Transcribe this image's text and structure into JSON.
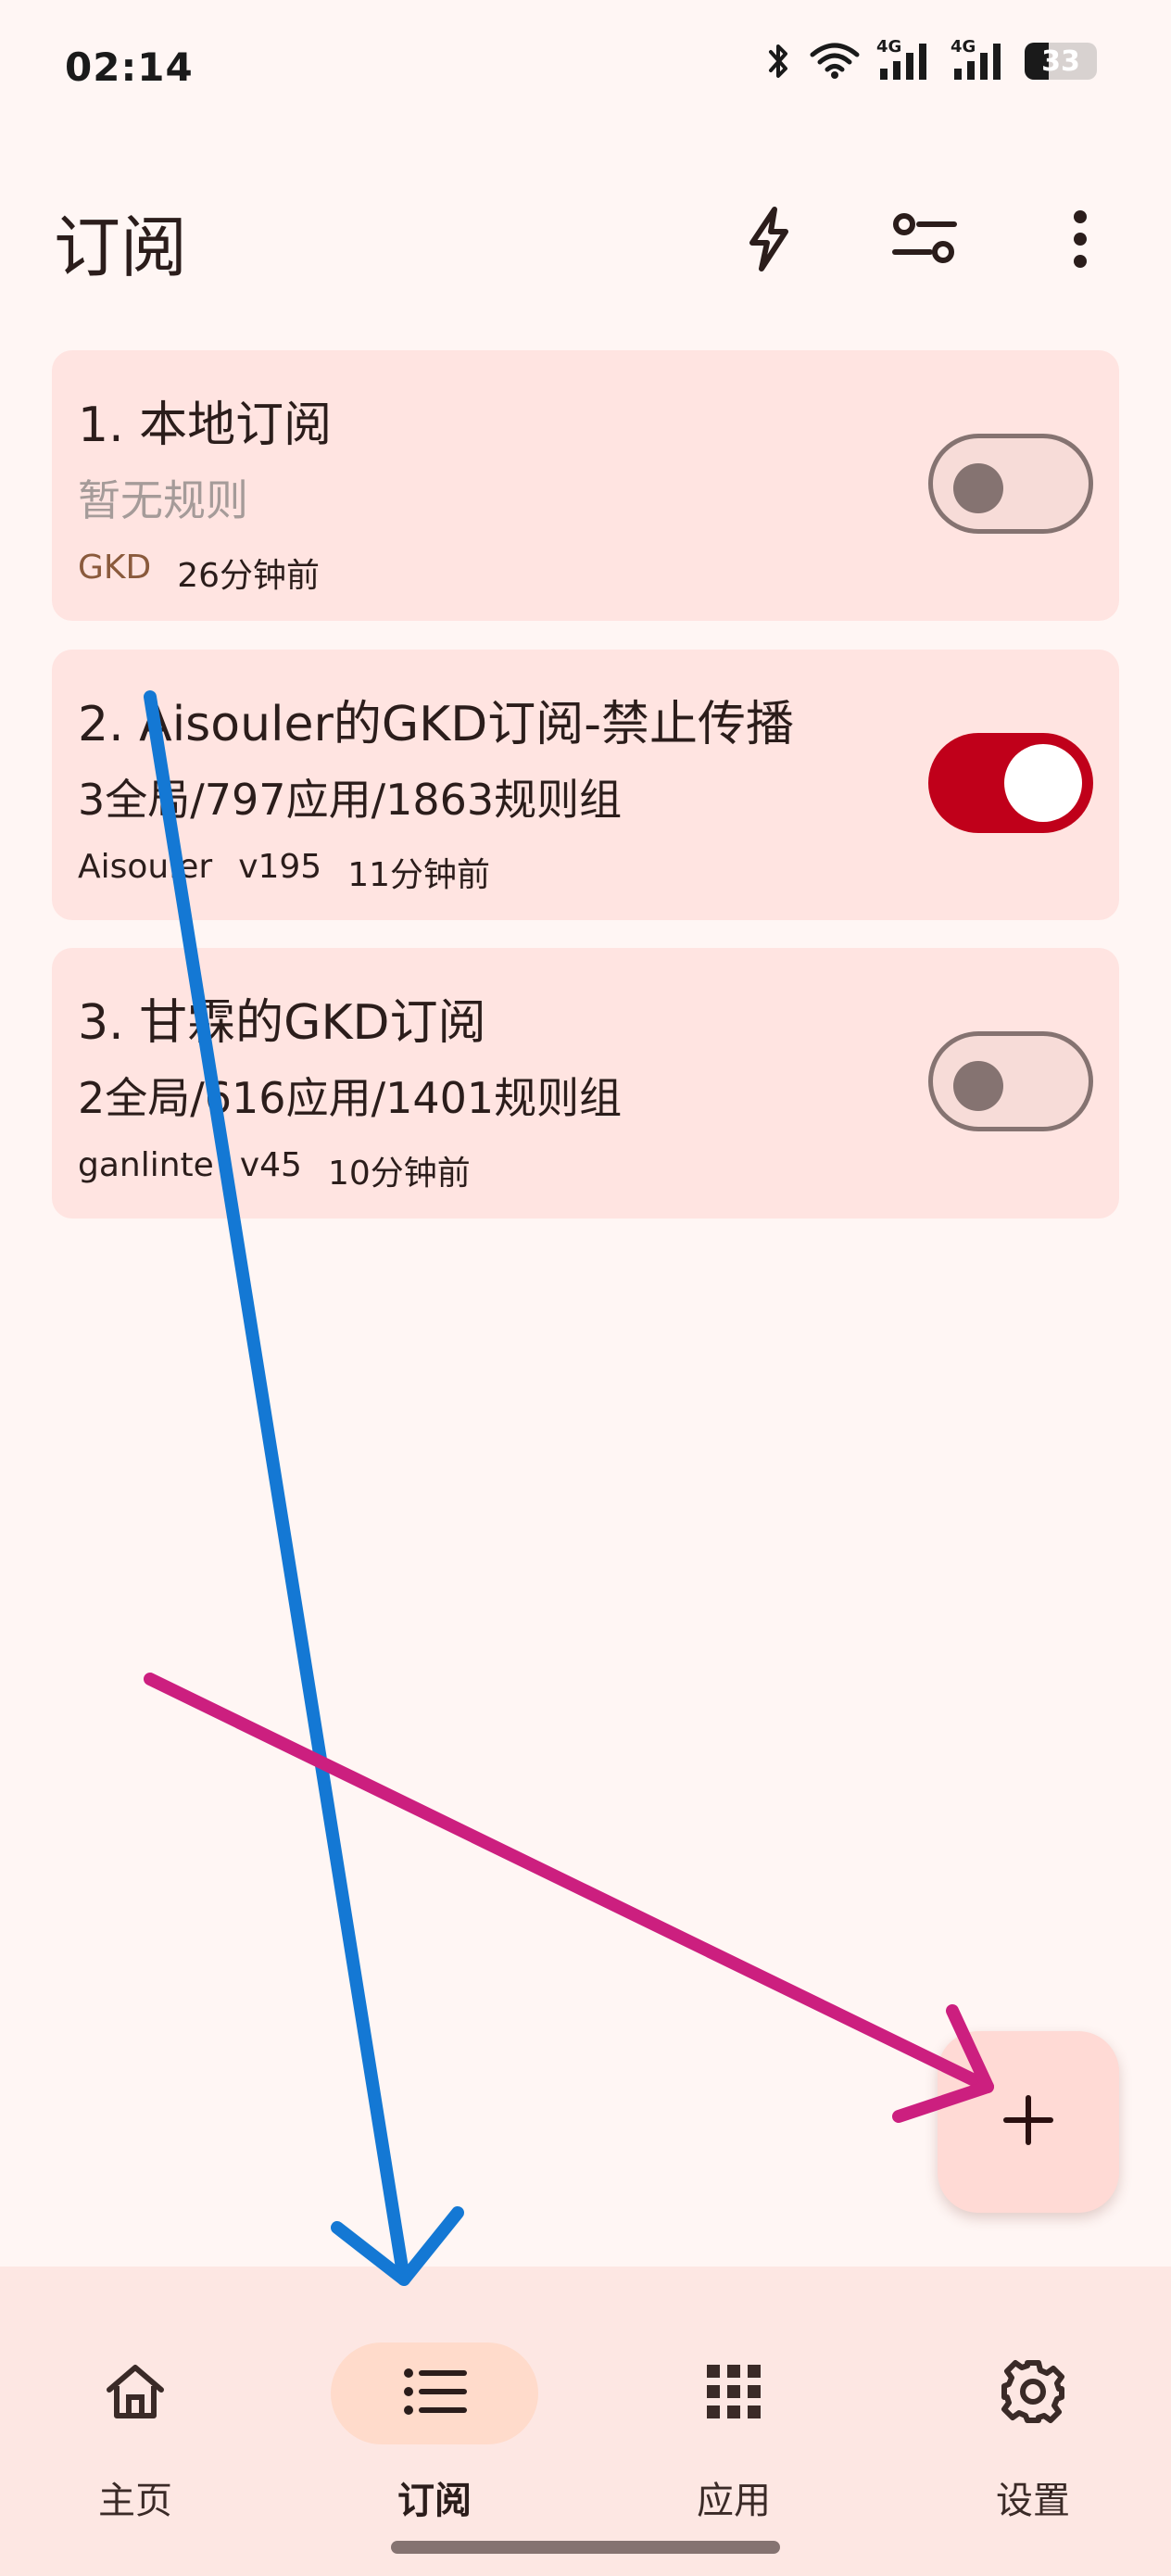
{
  "status_bar": {
    "time": "02:14",
    "battery": "33",
    "network_1": "4G",
    "network_2": "4G"
  },
  "app_bar": {
    "title": "订阅"
  },
  "subscriptions": [
    {
      "title": "1. 本地订阅",
      "subtitle": "暂无规则",
      "author": "GKD",
      "version": "",
      "updated": "26分钟前",
      "enabled": false
    },
    {
      "title": "2. Aisouler的GKD订阅-禁止传播",
      "subtitle": "3全局/797应用/1863规则组",
      "author": "Aisouler",
      "version": "v195",
      "updated": "11分钟前",
      "enabled": true
    },
    {
      "title": "3. 甘霖的GKD订阅",
      "subtitle": "2全局/616应用/1401规则组",
      "author": "ganlinte",
      "version": "v45",
      "updated": "10分钟前",
      "enabled": false
    }
  ],
  "fab": {
    "icon": "plus-icon"
  },
  "bottom_nav": {
    "items": [
      {
        "label": "主页",
        "icon": "home-icon",
        "active": false
      },
      {
        "label": "订阅",
        "icon": "list-icon",
        "active": true
      },
      {
        "label": "应用",
        "icon": "grid-icon",
        "active": false
      },
      {
        "label": "设置",
        "icon": "gear-icon",
        "active": false
      }
    ]
  },
  "colors": {
    "background": "#fff6f4",
    "card": "#ffe4e1",
    "switch_on": "#c0001a",
    "switch_off": "#857371",
    "nav_active": "#ffdbcb",
    "annotation_blue": "#1478d4",
    "annotation_magenta": "#cc1f7f"
  }
}
